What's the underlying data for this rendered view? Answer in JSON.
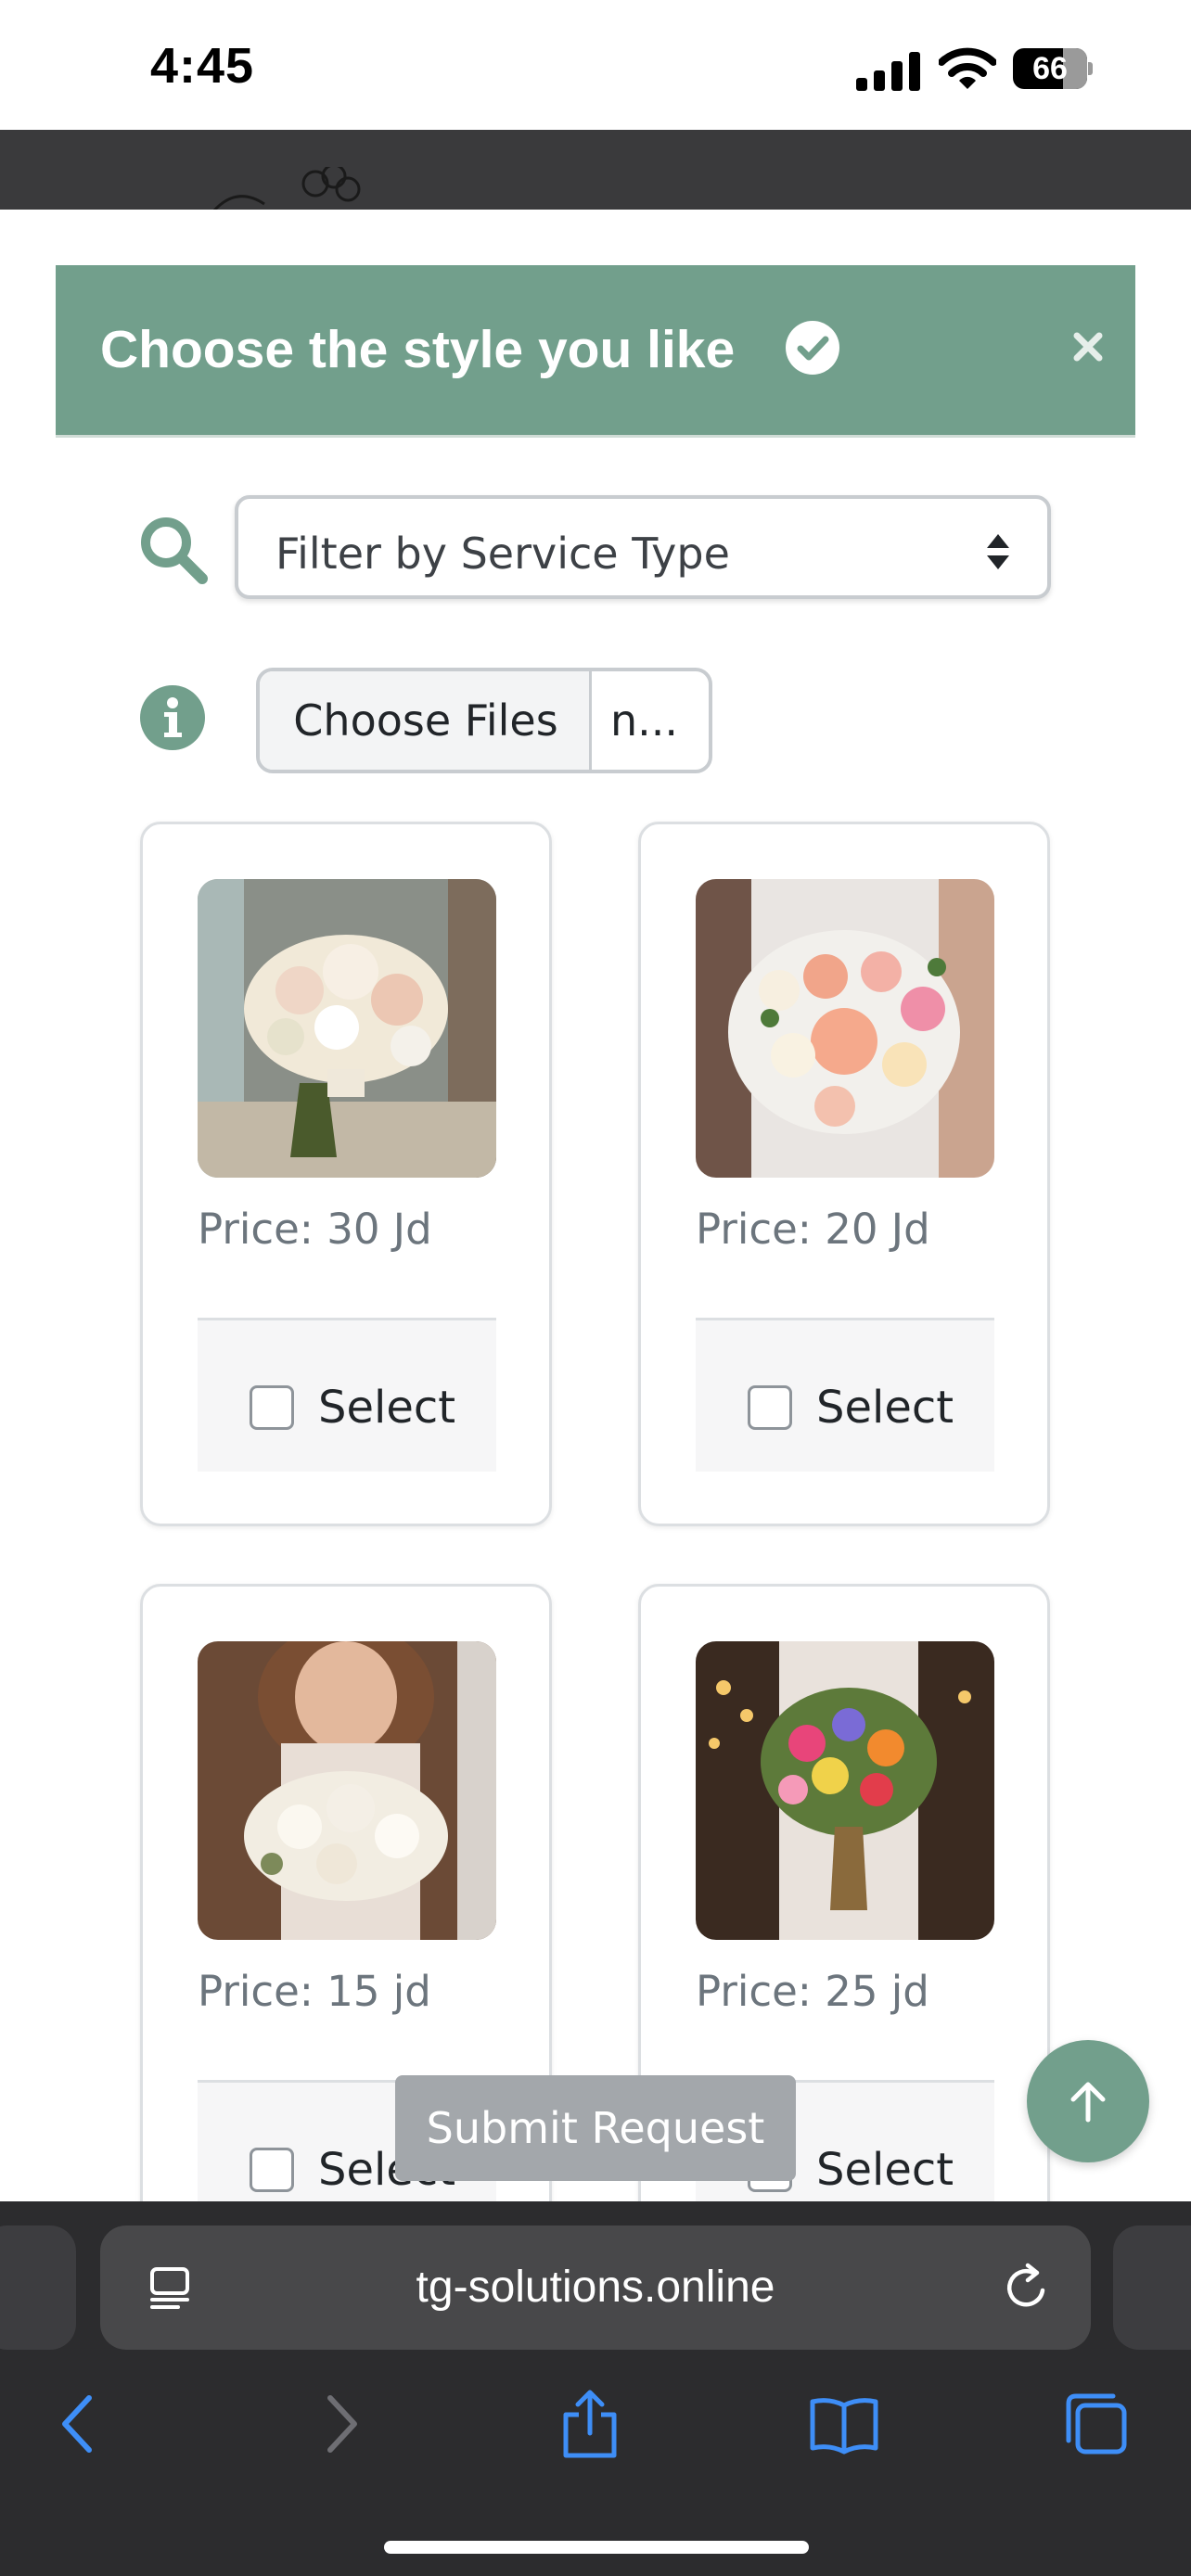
{
  "status_bar": {
    "time": "4:45",
    "battery": "66"
  },
  "modal": {
    "title": "Choose the style you like",
    "filter": {
      "placeholder": "Filter by Service Type"
    },
    "file_input": {
      "button_label": "Choose Files",
      "file_name": "n..."
    },
    "products": [
      {
        "price": "Price: 30 Jd",
        "select_label": "Select",
        "checked": false
      },
      {
        "price": "Price: 20 Jd",
        "select_label": "Select",
        "checked": false
      },
      {
        "price": "Price: 15 jd",
        "select_label": "Select",
        "checked": false
      },
      {
        "price": "Price: 25 jd",
        "select_label": "Select",
        "checked": false
      }
    ],
    "submit_label": "Submit Request"
  },
  "browser": {
    "url": "tg-solutions.online"
  },
  "colors": {
    "accent": "#729f8c",
    "submit_disabled": "#a3a7ab",
    "browser_chrome": "#2c2c2e",
    "toolbar_icon": "#3e8ef7"
  },
  "icons": {
    "header": [
      "check-circle-icon",
      "close-icon"
    ],
    "form": [
      "search-icon",
      "info-icon"
    ],
    "browser_toolbar": [
      "back-icon",
      "forward-icon",
      "share-icon",
      "bookmarks-icon",
      "tabs-icon",
      "reader-icon",
      "reload-icon"
    ]
  }
}
